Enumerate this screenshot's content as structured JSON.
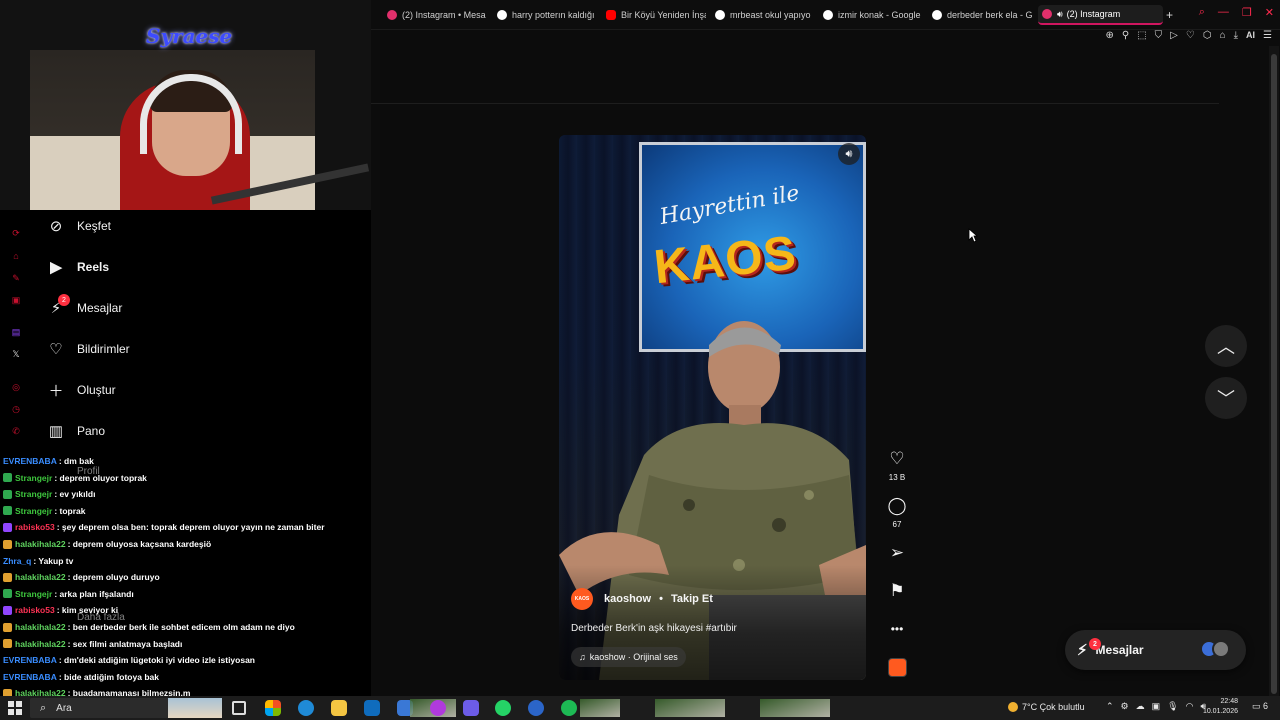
{
  "browser": {
    "tabs": [
      {
        "label": "(2) Instagram • Mesa",
        "color": "#e1306c"
      },
      {
        "label": "harry potterın kaldığı",
        "color": "#ffffff"
      },
      {
        "label": "Bir Köyü Yeniden İnşa",
        "color": "#ff0000"
      },
      {
        "label": "mrbeast okul yapıyo",
        "color": "#ffffff"
      },
      {
        "label": "izmir konak - Google",
        "color": "#ffffff"
      },
      {
        "label": "derbeder berk ela - G",
        "color": "#ffffff"
      },
      {
        "label": "(2) Instagram",
        "color": "#e1306c",
        "active": true
      }
    ],
    "new_tab": "+",
    "window_controls": [
      "⌕",
      "—",
      "❐",
      "✕"
    ],
    "toolbar_icons": [
      "zoom-icon",
      "pin-icon",
      "screenshot-icon",
      "shield-icon",
      "play-icon",
      "heart-icon",
      "extension-icon",
      "wallet-icon",
      "download-icon",
      "ai-icon",
      "menu-icon"
    ],
    "toolbar_ai_label": "AI"
  },
  "reel": {
    "brand_script": "Hayrettin ile",
    "brand_main": "KAOS",
    "author": "kaoshow",
    "author_avatar_text": "KAOS",
    "separator": "•",
    "follow": "Takip Et",
    "caption": "Derbeder Berk'in aşk hikayesi #artıbir",
    "audio": "kaoshow · Orijinal ses",
    "likes": "13 B",
    "comments": "67"
  },
  "instagram_nav": {
    "items": [
      {
        "label": "Keşfet",
        "icon": "compass-icon"
      },
      {
        "label": "Reels",
        "icon": "reels-icon"
      },
      {
        "label": "Mesajlar",
        "icon": "messenger-icon",
        "badge": "2"
      },
      {
        "label": "Bildirimler",
        "icon": "heart-icon"
      },
      {
        "label": "Oluştur",
        "icon": "plus-icon"
      },
      {
        "label": "Pano",
        "icon": "dashboard-icon"
      }
    ],
    "ghost_profile": "Profil",
    "ghost_more": "Daha fazla"
  },
  "messages_pill": {
    "label": "Mesajlar",
    "badge": "2"
  },
  "streamer": {
    "logo": "Syraese"
  },
  "chat": [
    {
      "user": "EVRENBABA",
      "msg": ": dm bak",
      "color": "#3a8dff",
      "badge": ""
    },
    {
      "user": "Strangejr",
      "msg": ": deprem oluyor toprak",
      "color": "#3ec73e",
      "badge": "#2fa84f"
    },
    {
      "user": "Strangejr",
      "msg": ": ev yıkıldı",
      "color": "#3ec73e",
      "badge": "#2fa84f"
    },
    {
      "user": "Strangejr",
      "msg": ": toprak",
      "color": "#3ec73e",
      "badge": "#2fa84f"
    },
    {
      "user": "rabisko53",
      "msg": ": şey deprem olsa ben: toprak deprem oluyor yayın ne zaman biter",
      "color": "#ff3355",
      "badge": "#9146ff"
    },
    {
      "user": "halakihala22",
      "msg": ": deprem oluyosa kaçsana kardeşiö",
      "color": "#5fd35f",
      "badge": "#e0a030"
    },
    {
      "user": "Zhra_q",
      "msg": ": Yakup tv",
      "color": "#3a8dff",
      "badge": ""
    },
    {
      "user": "halakihala22",
      "msg": ": deprem oluyo duruyo",
      "color": "#5fd35f",
      "badge": "#e0a030"
    },
    {
      "user": "Strangejr",
      "msg": ": arka plan ifşalandı",
      "color": "#3ec73e",
      "badge": "#2fa84f"
    },
    {
      "user": "rabisko53",
      "msg": ": kim seviyor ki",
      "color": "#ff3355",
      "badge": "#9146ff"
    },
    {
      "user": "halakihala22",
      "msg": ": ben derbeder berk ile sohbet edicem olm adam ne diyo",
      "color": "#5fd35f",
      "badge": "#e0a030"
    },
    {
      "user": "halakihala22",
      "msg": ": sex filmi anlatmaya başladı",
      "color": "#5fd35f",
      "badge": "#e0a030"
    },
    {
      "user": "EVRENBABA",
      "msg": ": dm'deki atdiğim lügetoki iyi video izle istiyosan",
      "color": "#3a8dff",
      "badge": ""
    },
    {
      "user": "EVRENBABA",
      "msg": ": bide atdiğim fotoya bak",
      "color": "#3a8dff",
      "badge": ""
    },
    {
      "user": "halakihala22",
      "msg": ": buadamamanası bilmezsin.m",
      "color": "#5fd35f",
      "badge": "#e0a030"
    }
  ],
  "taskbar": {
    "search_placeholder": "Ara",
    "weather": "7°C Çok bulutlu",
    "time": "22:48",
    "date": "10.01.2026",
    "notifications": "6"
  }
}
